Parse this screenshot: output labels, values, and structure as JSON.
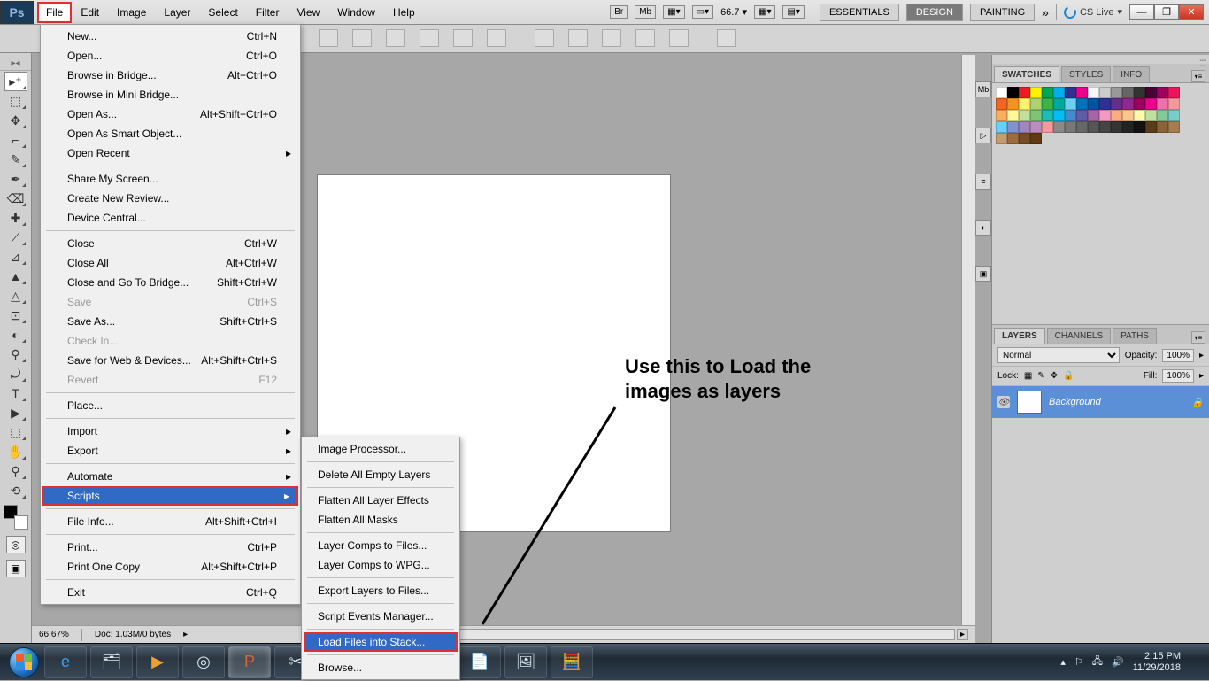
{
  "app": {
    "logo": "Ps"
  },
  "menubar": {
    "items": [
      "File",
      "Edit",
      "Image",
      "Layer",
      "Select",
      "Filter",
      "View",
      "Window",
      "Help"
    ],
    "active_index": 0,
    "zoom": "66.7",
    "workspaces": [
      "ESSENTIALS",
      "DESIGN",
      "PAINTING"
    ],
    "workspace_active": 1,
    "cs_live": "CS Live"
  },
  "file_menu": [
    {
      "label": "New...",
      "short": "Ctrl+N"
    },
    {
      "label": "Open...",
      "short": "Ctrl+O"
    },
    {
      "label": "Browse in Bridge...",
      "short": "Alt+Ctrl+O"
    },
    {
      "label": "Browse in Mini Bridge..."
    },
    {
      "label": "Open As...",
      "short": "Alt+Shift+Ctrl+O"
    },
    {
      "label": "Open As Smart Object..."
    },
    {
      "label": "Open Recent",
      "sub": true
    },
    {
      "sep": true
    },
    {
      "label": "Share My Screen..."
    },
    {
      "label": "Create New Review..."
    },
    {
      "label": "Device Central..."
    },
    {
      "sep": true
    },
    {
      "label": "Close",
      "short": "Ctrl+W"
    },
    {
      "label": "Close All",
      "short": "Alt+Ctrl+W"
    },
    {
      "label": "Close and Go To Bridge...",
      "short": "Shift+Ctrl+W"
    },
    {
      "label": "Save",
      "short": "Ctrl+S",
      "disabled": true
    },
    {
      "label": "Save As...",
      "short": "Shift+Ctrl+S"
    },
    {
      "label": "Check In...",
      "disabled": true
    },
    {
      "label": "Save for Web & Devices...",
      "short": "Alt+Shift+Ctrl+S"
    },
    {
      "label": "Revert",
      "short": "F12",
      "disabled": true
    },
    {
      "sep": true
    },
    {
      "label": "Place..."
    },
    {
      "sep": true
    },
    {
      "label": "Import",
      "sub": true
    },
    {
      "label": "Export",
      "sub": true
    },
    {
      "sep": true
    },
    {
      "label": "Automate",
      "sub": true
    },
    {
      "label": "Scripts",
      "sub": true,
      "selected": true
    },
    {
      "sep": true
    },
    {
      "label": "File Info...",
      "short": "Alt+Shift+Ctrl+I"
    },
    {
      "sep": true
    },
    {
      "label": "Print...",
      "short": "Ctrl+P"
    },
    {
      "label": "Print One Copy",
      "short": "Alt+Shift+Ctrl+P"
    },
    {
      "sep": true
    },
    {
      "label": "Exit",
      "short": "Ctrl+Q"
    }
  ],
  "scripts_menu": [
    {
      "label": "Image Processor..."
    },
    {
      "sep": true
    },
    {
      "label": "Delete All Empty Layers"
    },
    {
      "sep": true
    },
    {
      "label": "Flatten All Layer Effects"
    },
    {
      "label": "Flatten All Masks"
    },
    {
      "sep": true
    },
    {
      "label": "Layer Comps to Files..."
    },
    {
      "label": "Layer Comps to WPG..."
    },
    {
      "sep": true
    },
    {
      "label": "Export Layers to Files..."
    },
    {
      "sep": true
    },
    {
      "label": "Script Events Manager..."
    },
    {
      "sep": true
    },
    {
      "label": "Load Files into Stack...",
      "selected": true
    },
    {
      "sep": true
    },
    {
      "label": "Browse..."
    }
  ],
  "annotation": {
    "line1": "Use this to Load the",
    "line2": "images as layers"
  },
  "panels": {
    "swatches_tabs": [
      "SWATCHES",
      "STYLES",
      "INFO"
    ],
    "layers_tabs": [
      "LAYERS",
      "CHANNELS",
      "PATHS"
    ],
    "blend_mode": "Normal",
    "opacity_label": "Opacity:",
    "opacity": "100%",
    "lock_label": "Lock:",
    "fill_label": "Fill:",
    "fill": "100%",
    "layer_name": "Background"
  },
  "swatch_colors": [
    "#ffffff",
    "#000000",
    "#ed1c24",
    "#fff200",
    "#00a651",
    "#00aeef",
    "#2e3192",
    "#ec008c",
    "#f7f7f7",
    "#cccccc",
    "#999999",
    "#666666",
    "#333333",
    "#470137",
    "#9e005d",
    "#ed145b",
    "#f26522",
    "#f7941d",
    "#fff568",
    "#acd373",
    "#39b54a",
    "#00a99d",
    "#6dcff6",
    "#0072bc",
    "#0054a6",
    "#2e3192",
    "#662d91",
    "#92278f",
    "#9e005d",
    "#ed008c",
    "#f06eaa",
    "#f5989d",
    "#fbaf5d",
    "#fff799",
    "#c4df9b",
    "#7cc576",
    "#1cbbb4",
    "#00bff3",
    "#438ccb",
    "#605ca8",
    "#a864a8",
    "#f49ac1",
    "#f9ad81",
    "#fdc68a",
    "#fff9b0",
    "#c0e0a0",
    "#82ca9c",
    "#7accc8",
    "#6dcff6",
    "#8393ca",
    "#a186be",
    "#bd8cbf",
    "#f6989d",
    "#898989",
    "#787878",
    "#676767",
    "#565656",
    "#454545",
    "#343434",
    "#232323",
    "#121212",
    "#5a3b1a",
    "#8c6239",
    "#a67c52",
    "#c69c6d",
    "#9e6b3a",
    "#754c24",
    "#603913"
  ],
  "status": {
    "zoom": "66.67%",
    "doc": "Doc: 1.03M/0 bytes"
  },
  "taskbar": {
    "time": "2:15 PM",
    "date": "11/29/2018"
  },
  "tool_glyphs": [
    "▸⁺",
    "⬚",
    "✥",
    "⌐",
    "✎",
    "✒",
    "⌫",
    "✚",
    "⟋",
    "⊿",
    "▲",
    "△",
    "⊡",
    "◐",
    "⚲",
    "⤾",
    "T",
    "▶",
    "⬚",
    "✋",
    "⚲",
    "⟲"
  ]
}
